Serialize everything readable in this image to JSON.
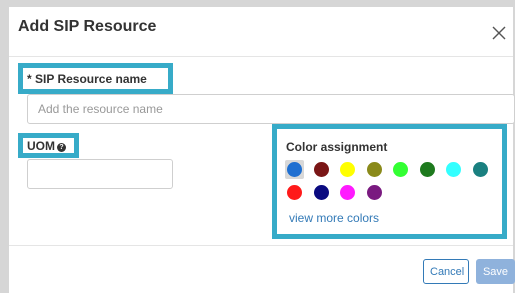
{
  "dialog": {
    "title": "Add SIP Resource",
    "close_icon": "close-icon"
  },
  "fields": {
    "resource_name_label": "* SIP Resource name",
    "resource_name_placeholder": "Add the resource name",
    "resource_name_value": "",
    "uom_label": "UOM",
    "uom_help_icon": "question-circle-icon",
    "uom_value": ""
  },
  "color_assignment": {
    "label": "Color assignment",
    "selected_index": 0,
    "swatches": [
      "#1f6fd1",
      "#7a1616",
      "#ffff00",
      "#8a8a1a",
      "#33ff33",
      "#1e7a1e",
      "#33ffff",
      "#1a8080",
      "#ff1a1a",
      "#0a0a80",
      "#ff1aff",
      "#7a1a80"
    ],
    "more_link": "view more colors"
  },
  "highlight_color": "#37abc8",
  "footer": {
    "cancel_label": "Cancel",
    "save_label": "Save"
  }
}
